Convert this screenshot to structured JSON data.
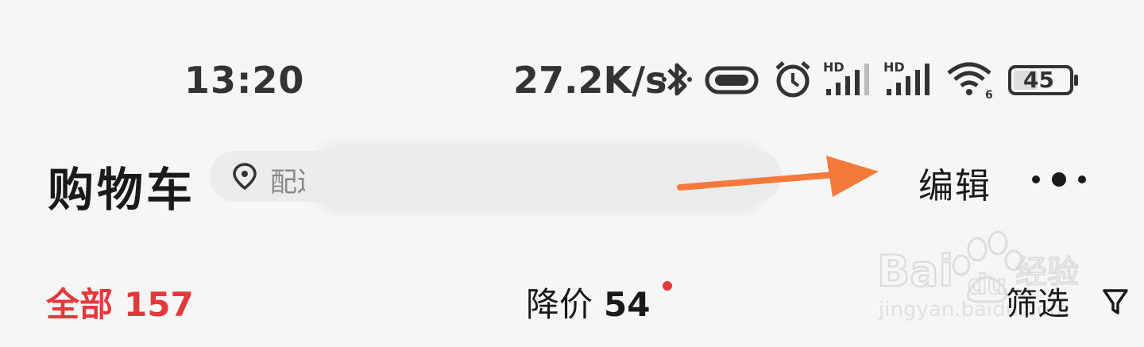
{
  "status_bar": {
    "time": "13:20",
    "net_speed": "27.2K/s",
    "battery": "45",
    "icons": [
      "bluetooth-icon",
      "vibrate-icon",
      "alarm-icon",
      "signal-hd-icon",
      "signal-hd-icon",
      "wifi-icon",
      "battery-icon"
    ]
  },
  "header": {
    "title": "购物车",
    "address_prefix": "配送至",
    "edit_label": "编辑",
    "more_icon": "more-dots-icon"
  },
  "tabs": [
    {
      "label": "全部",
      "count": "157",
      "active": true
    },
    {
      "label": "降价",
      "count": "54",
      "active": false
    }
  ],
  "filter": {
    "label": "筛选",
    "icon": "filter-funnel-icon"
  },
  "watermark": {
    "brand": "Bai",
    "brand_suffix": "du",
    "product": "经验",
    "url": "jingyan.baidu.com"
  },
  "colors": {
    "accent": "#e4393c",
    "arrow": "#f47a3c",
    "background": "#f6f6f6"
  }
}
